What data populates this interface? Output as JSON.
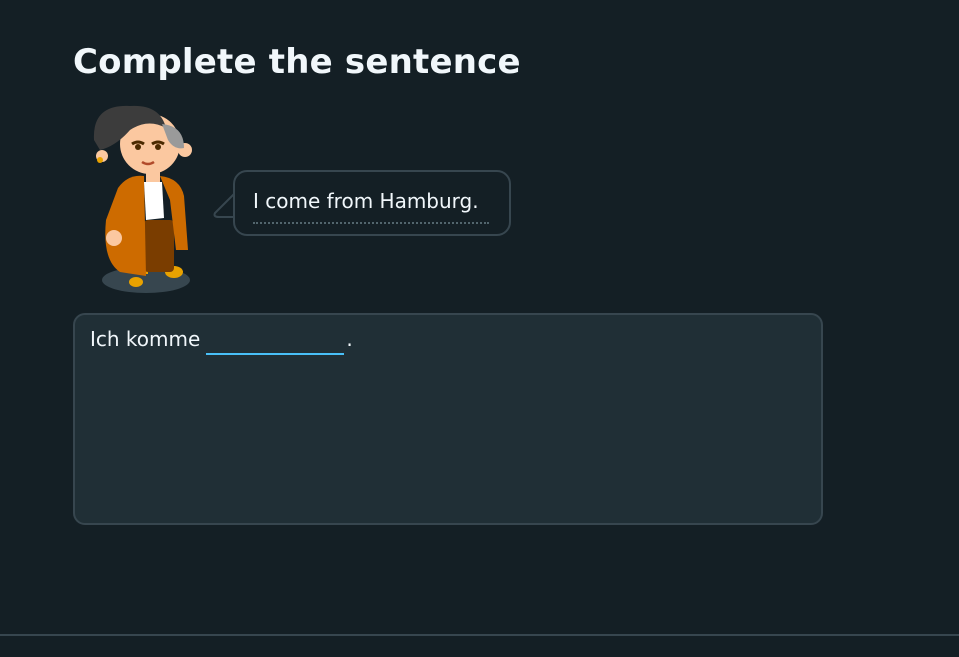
{
  "header": {
    "title": "Complete the sentence"
  },
  "speech": {
    "text": "I come from Hamburg."
  },
  "exercise": {
    "prefix": "Ich komme",
    "blank_value": "",
    "suffix": "."
  },
  "colors": {
    "background": "#141f25",
    "panel": "#202f36",
    "border": "#37464f",
    "blank_accent": "#49c0f8",
    "text": "#f1f7fb"
  },
  "icons": {
    "character": "character-illustration-icon"
  }
}
